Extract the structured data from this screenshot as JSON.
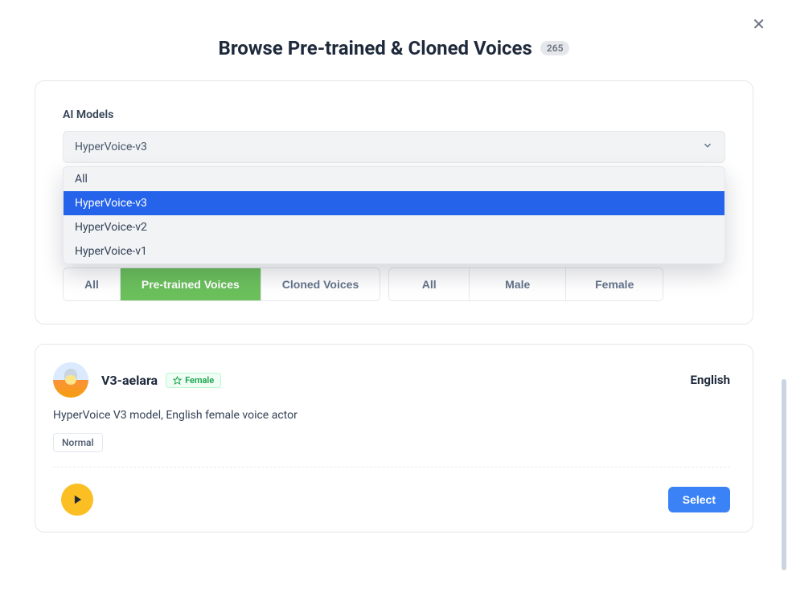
{
  "header": {
    "title": "Browse Pre-trained & Cloned Voices",
    "count": "265",
    "close_icon_label": "close"
  },
  "filters": {
    "ai_models_label": "AI Models",
    "select": {
      "value": "HyperVoice-v3",
      "options": [
        "All",
        "HyperVoice-v3",
        "HyperVoice-v2",
        "HyperVoice-v1"
      ],
      "selected_index": 1
    },
    "type_tabs": [
      "All",
      "Pre-trained Voices",
      "Cloned Voices"
    ],
    "type_active_index": 1,
    "gender_tabs": [
      "All",
      "Male",
      "Female"
    ],
    "gender_active_index": -1
  },
  "voices": [
    {
      "name": "V3-aelara",
      "gender_label": "Female",
      "language": "English",
      "description": "HyperVoice V3 model, English female voice actor",
      "tags": [
        "Normal"
      ],
      "select_label": "Select"
    }
  ]
}
